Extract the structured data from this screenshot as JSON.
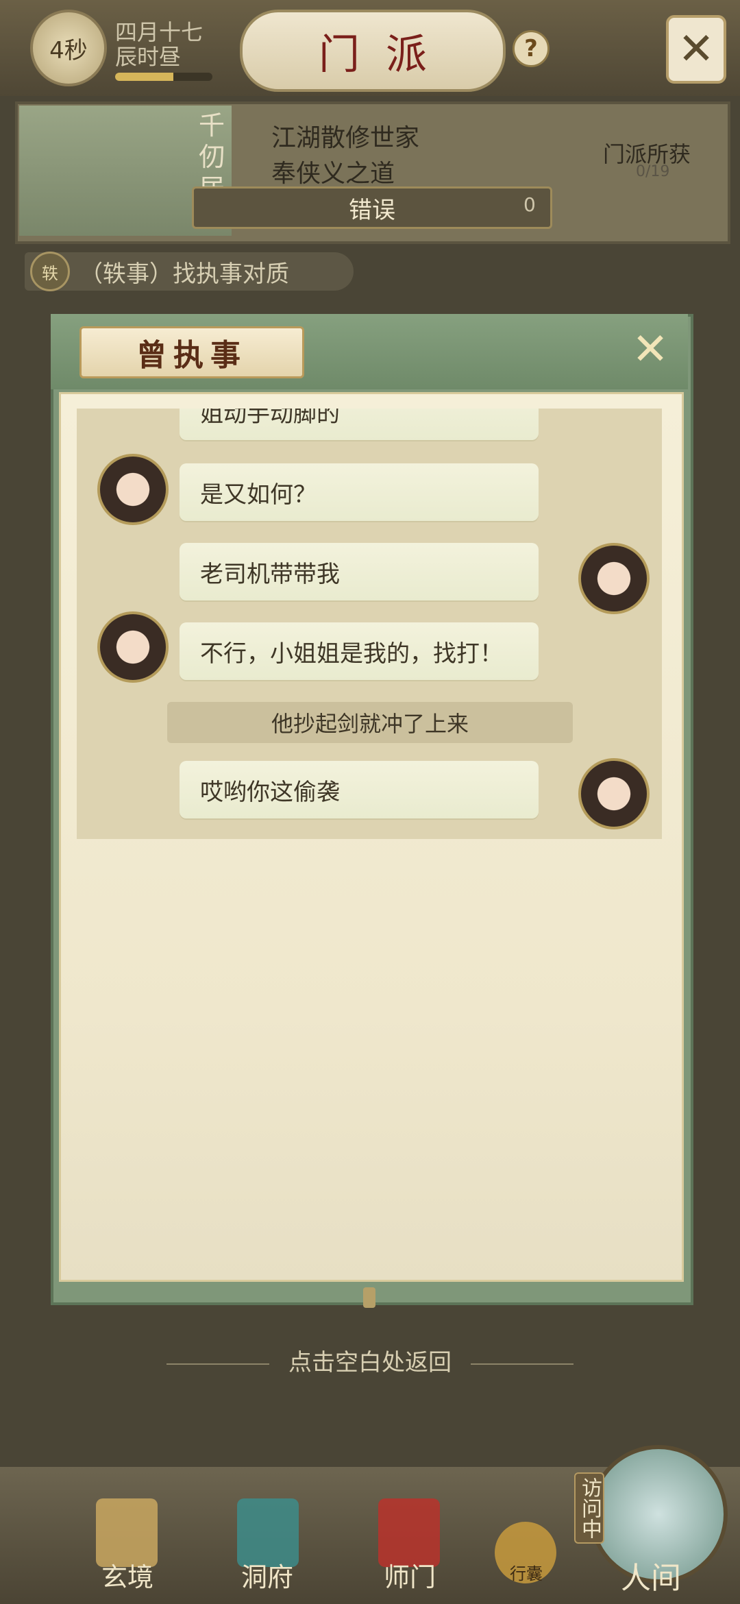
{
  "topbar": {
    "timer": "4秒",
    "date_line1": "四月十七",
    "date_line2": "辰时昼",
    "day_progress": 0.6,
    "title": "门派",
    "help": "?",
    "close": "✕"
  },
  "sect": {
    "place_name": "千仞居",
    "line1": "江湖散修世家",
    "line2": "奉侠义之道",
    "gain_label": "门派所获",
    "gain_count": "0/19",
    "error_text": "错误",
    "coin": "0"
  },
  "quest": {
    "icon_label": "轶",
    "text": "（轶事）找执事对质"
  },
  "dialog": {
    "title": "曾执事",
    "close": "✕",
    "messages": [
      {
        "side": "left",
        "text": "姐动手动脚的"
      },
      {
        "side": "left",
        "text": "是又如何？"
      },
      {
        "side": "right",
        "text": "老司机带带我"
      },
      {
        "side": "left",
        "text": "不行，小姐姐是我的，找打！"
      },
      {
        "side": "narration",
        "text": "他抄起剑就冲了上来"
      },
      {
        "side": "right",
        "text": "哎哟你这偷袭"
      }
    ]
  },
  "back_hint": "点击空白处返回",
  "nav": {
    "items": [
      "玄境",
      "洞府",
      "师门",
      "行囊",
      "人间"
    ],
    "visit_label": "访问中"
  },
  "colors": {
    "modal_green": "#7f9779",
    "paper": "#f5efd8",
    "bubble": "#f3f2dc",
    "title_red": "#7a1f1a"
  }
}
